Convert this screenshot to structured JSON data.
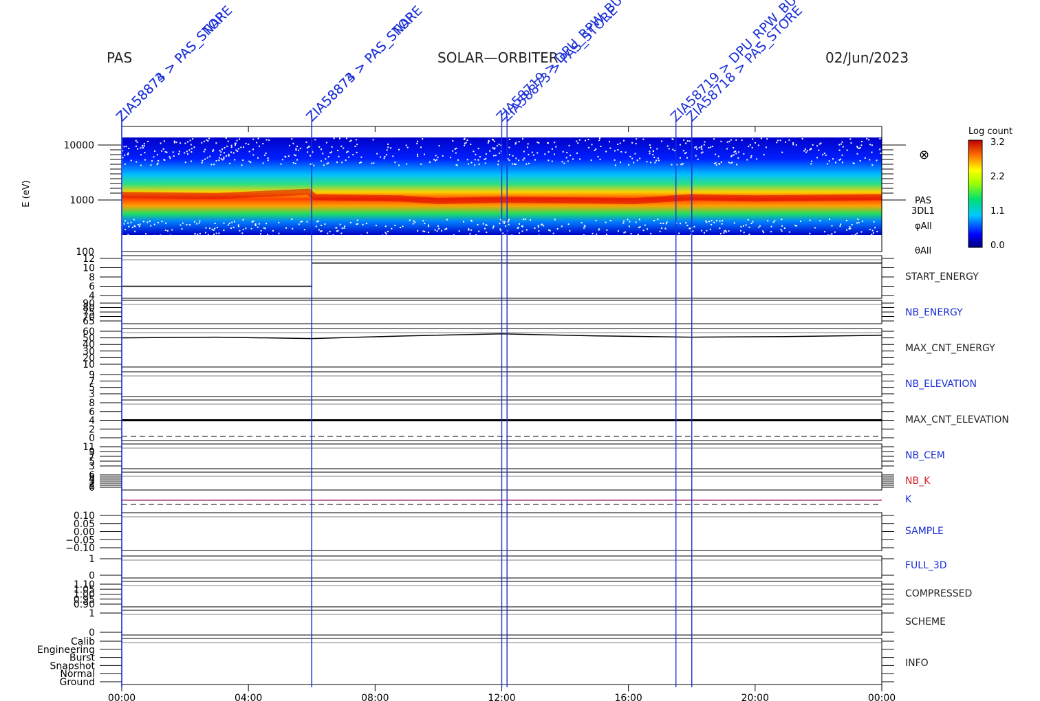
{
  "header": {
    "left": "PAS",
    "center": "SOLAR—ORBITER",
    "right": "02/Jun/2023"
  },
  "spectrogram": {
    "ylabel": "E (eV)",
    "yticks": [
      "10000",
      "1000",
      "100"
    ],
    "side_labels": [
      "PAS",
      "3DL1",
      "φAll",
      "θAll"
    ],
    "colorbar": {
      "title": "Log count",
      "ticks": [
        "3.2",
        "2.2",
        "1.1",
        "0.0"
      ],
      "max": 3.2,
      "min": 0.0
    },
    "symbol": "⊗"
  },
  "events": [
    {
      "time": "00:00",
      "label": "ZIA58873 > PAS_STORE",
      "color": "#1a2fd6"
    },
    {
      "time": "00:00",
      "label": "ZIA58874 > PAS_SNAP",
      "color": "#1a2fd6"
    },
    {
      "time": "06:00",
      "label": "ZIA58874 > PAS_STORE",
      "color": "#1a2fd6"
    },
    {
      "time": "06:00",
      "label": "ZIA58873 > PAS_SNAP",
      "color": "#1a2fd6"
    },
    {
      "time": "12:00",
      "label": "ZIA58719 > DPU_RPW_BURST",
      "color": "#1a2fd6"
    },
    {
      "time": "12:10",
      "label": "ZIA58873 > PAS_STORE",
      "color": "#1a2fd6"
    },
    {
      "time": "17:30",
      "label": "ZIA58719 > DPU_RPW_BURST",
      "color": "#1a2fd6"
    },
    {
      "time": "18:00",
      "label": "ZIA58718 > PAS_STORE",
      "color": "#1a2fd6"
    }
  ],
  "panels": [
    {
      "name": "START_ENERGY",
      "label_color": "#222",
      "ticks": [
        "12",
        "10",
        "8",
        "6",
        "4"
      ]
    },
    {
      "name": "NB_ENERGY",
      "label_color": "#1a2fd6",
      "ticks": [
        "90",
        "80",
        "75",
        "70",
        "65"
      ]
    },
    {
      "name": "MAX_CNT_ENERGY",
      "label_color": "#222",
      "ticks": [
        "60",
        "50",
        "40",
        "30",
        "20",
        "10"
      ]
    },
    {
      "name": "NB_ELEVATION",
      "label_color": "#1a2fd6",
      "ticks": [
        "9",
        "7",
        "5",
        "3"
      ]
    },
    {
      "name": "MAX_CNT_ELEVATION",
      "label_color": "#222",
      "ticks": [
        "8",
        "6",
        "4",
        "2",
        "0"
      ]
    },
    {
      "name": "NB_CEM",
      "label_color": "#1a2fd6",
      "ticks": [
        "11",
        "9",
        "7",
        "5",
        "3"
      ]
    },
    {
      "name": "NB_K",
      "label_color": "#d42020",
      "ticks": [
        "6",
        "5",
        "4",
        "3",
        "2",
        "1",
        "0"
      ]
    },
    {
      "name": "K",
      "label_color": "#1a2fd6",
      "ticks": []
    },
    {
      "name": "SAMPLE",
      "label_color": "#1a2fd6",
      "ticks": [
        "0.10",
        "0.05",
        "0.00",
        "−0.05",
        "−0.10"
      ]
    },
    {
      "name": "FULL_3D",
      "label_color": "#1a2fd6",
      "ticks": [
        "1",
        "0"
      ]
    },
    {
      "name": "COMPRESSED",
      "label_color": "#222",
      "ticks": [
        "1.10",
        "1.05",
        "1.00",
        "0.95",
        "0.90"
      ]
    },
    {
      "name": "SCHEME",
      "label_color": "#222",
      "ticks": [
        "1",
        "0"
      ]
    },
    {
      "name": "INFO",
      "label_color": "#222",
      "ticks": [
        "Calib",
        "Engineering",
        "Burst",
        "Snapshot",
        "Normal",
        "Ground"
      ]
    }
  ],
  "chart_data": {
    "type": "heatmap",
    "title": "",
    "xlabel": "",
    "ylabel": "E (eV)",
    "x_ticks": [
      "00:00",
      "04:00",
      "08:00",
      "12:00",
      "16:00",
      "20:00",
      "00:00"
    ],
    "xlim_hours": [
      0,
      24
    ],
    "y_scale": "log",
    "ylim": [
      100,
      20000
    ],
    "peak_energy_eV": {
      "hours": [
        0,
        3,
        5.9,
        6.1,
        8.8,
        10,
        12,
        16.2,
        18,
        20,
        24
      ],
      "values": [
        1100,
        1050,
        1250,
        1000,
        950,
        850,
        900,
        850,
        1000,
        950,
        1000
      ]
    },
    "series": [
      {
        "name": "START_ENERGY",
        "hours": [
          0,
          6,
          6,
          18,
          18,
          24
        ],
        "values": [
          6,
          6,
          11,
          11,
          11,
          11
        ]
      },
      {
        "name": "MAX_CNT_ENERGY",
        "hours": [
          0,
          3,
          6,
          9,
          12,
          15,
          18,
          21,
          24
        ],
        "values": [
          50,
          51,
          49,
          53,
          56,
          53,
          51,
          52,
          54
        ]
      },
      {
        "name": "MAX_CNT_ELEVATION",
        "hours": [
          0,
          6,
          12,
          18,
          24
        ],
        "values": [
          4,
          4,
          4,
          4,
          4
        ]
      },
      {
        "name": "K",
        "hours": [
          0,
          24
        ],
        "values": [
          1,
          1
        ]
      }
    ]
  }
}
